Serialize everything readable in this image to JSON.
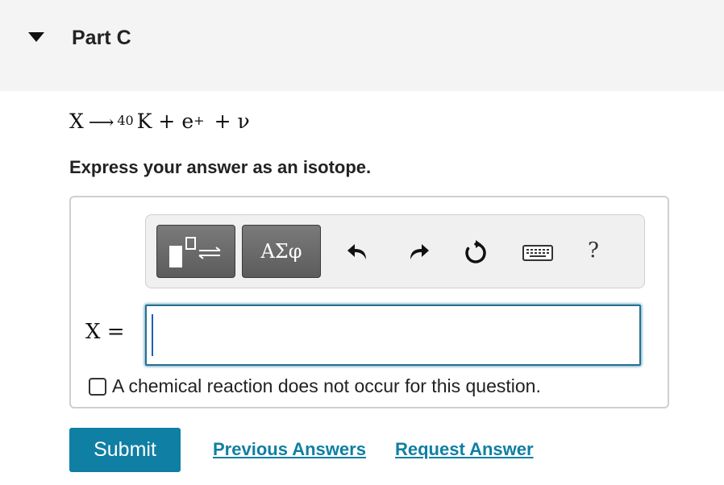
{
  "part": {
    "title": "Part C"
  },
  "equation": {
    "reactant": "X",
    "arrow": "⟶",
    "mass_number": "40",
    "product_element": "K",
    "plus": "+",
    "positron": "e",
    "positron_charge": "+",
    "neutrino": "ν"
  },
  "instruction": "Express your answer as an isotope.",
  "toolbar": {
    "greek_label": "ΑΣφ",
    "help_label": "?",
    "icons": [
      "templates-icon",
      "greek-letters-icon",
      "undo-icon",
      "redo-icon",
      "reset-icon",
      "keyboard-icon",
      "help-icon"
    ]
  },
  "answer": {
    "label": "X =",
    "value": "",
    "no_reaction_label": "A chemical reaction does not occur for this question.",
    "no_reaction_checked": false
  },
  "actions": {
    "submit_label": "Submit",
    "previous_answers_label": "Previous Answers",
    "request_answer_label": "Request Answer"
  },
  "colors": {
    "accent": "#0f7fa3",
    "input_border": "#2a6f8f",
    "header_bg": "#f4f4f4",
    "toolbar_button": "#6b6b6b"
  }
}
